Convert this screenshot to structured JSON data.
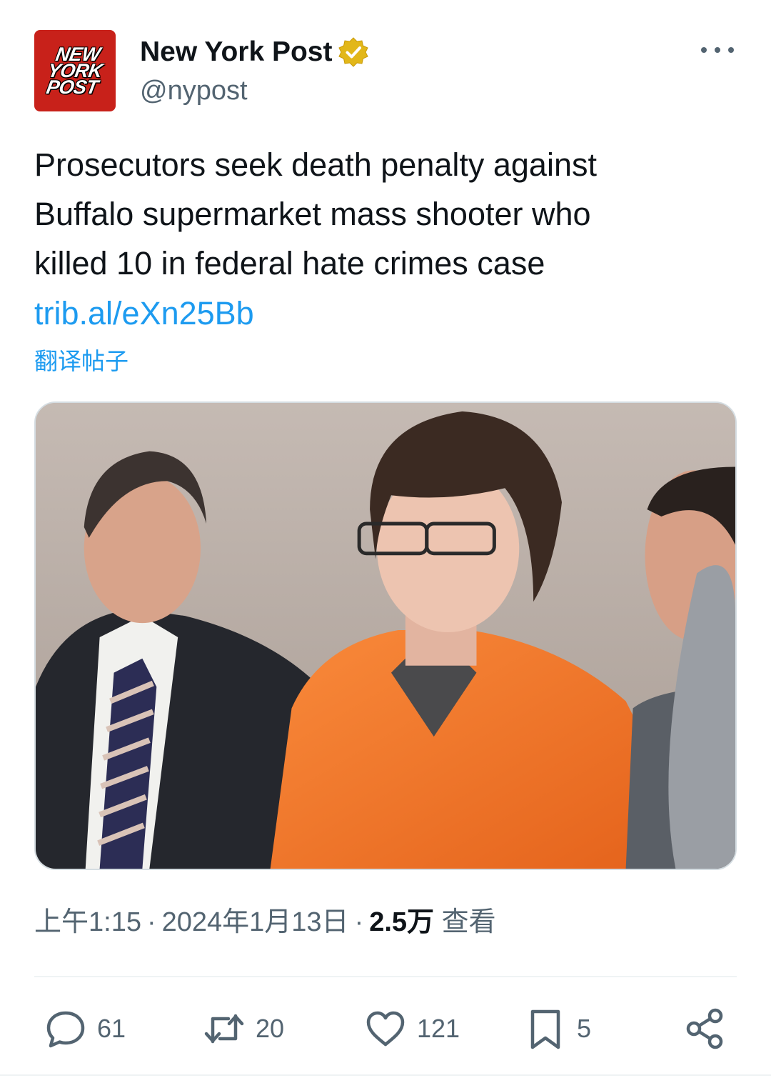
{
  "account": {
    "display_name": "New York Post",
    "handle": "@nypost",
    "logo_lines": [
      "NEW",
      "YORK",
      "POST"
    ],
    "verified_badge": "gold-verified-icon"
  },
  "tweet": {
    "text_lines": [
      "Prosecutors seek death penalty against",
      "Buffalo supermarket mass shooter who",
      "killed 10 in federal hate crimes case"
    ],
    "link": "trib.al/eXn25Bb",
    "translate_label": "翻译帖子"
  },
  "meta": {
    "time": "上午1:15",
    "date": "2024年1月13日",
    "views_count": "2.5万",
    "views_label": "查看",
    "separator": "·"
  },
  "actions": {
    "replies": "61",
    "reposts": "20",
    "likes": "121",
    "bookmarks": "5"
  },
  "colors": {
    "accent": "#1d9bf0",
    "brand_red": "#c8211a",
    "secondary_text": "#536471"
  }
}
